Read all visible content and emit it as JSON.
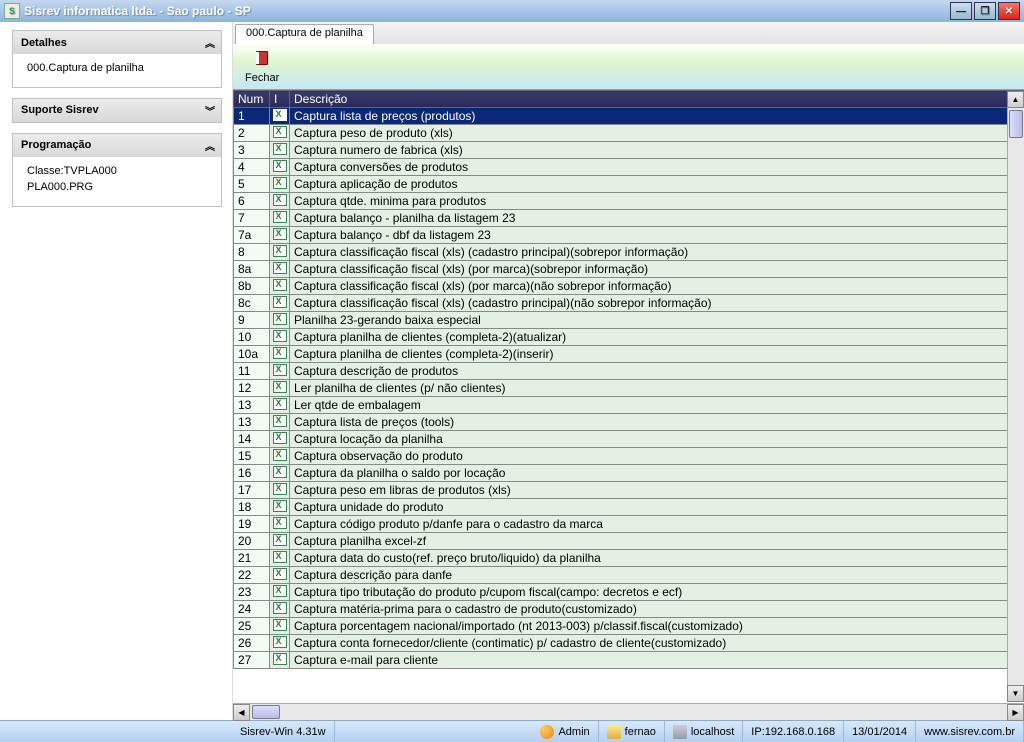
{
  "window": {
    "title": "Sisrev informatica ltda. - Sao paulo - SP"
  },
  "sidebar": {
    "detalhes": {
      "title": "Detalhes",
      "item": "000.Captura de planilha"
    },
    "suporte": {
      "title": "Suporte Sisrev"
    },
    "programacao": {
      "title": "Programação",
      "line1": "Classe:TVPLA000",
      "line2": "PLA000.PRG"
    }
  },
  "tab": {
    "label": "000.Captura de planilha"
  },
  "toolbar": {
    "fechar": "Fechar"
  },
  "grid": {
    "headers": {
      "num": "Num",
      "i": "I",
      "desc": "Descrição"
    },
    "rows": [
      {
        "num": "1",
        "desc": "Captura lista de preços (produtos)",
        "selected": true
      },
      {
        "num": "2",
        "desc": "Captura peso de produto (xls)"
      },
      {
        "num": "3",
        "desc": "Captura numero de fabrica (xls)"
      },
      {
        "num": "4",
        "desc": "Captura conversões de produtos"
      },
      {
        "num": "5",
        "desc": "Captura aplicação de produtos"
      },
      {
        "num": "6",
        "desc": "Captura qtde. minima para produtos"
      },
      {
        "num": "7",
        "desc": "Captura balanço - planilha da listagem 23"
      },
      {
        "num": "7a",
        "desc": "Captura balanço - dbf da listagem 23"
      },
      {
        "num": "8",
        "desc": "Captura classificação fiscal (xls) (cadastro principal)(sobrepor informação)"
      },
      {
        "num": "8a",
        "desc": "Captura classificação fiscal (xls) (por marca)(sobrepor informação)"
      },
      {
        "num": "8b",
        "desc": "Captura classificação fiscal (xls) (por marca)(não sobrepor informação)"
      },
      {
        "num": "8c",
        "desc": "Captura classificação fiscal (xls) (cadastro principal)(não sobrepor informação)"
      },
      {
        "num": "9",
        "desc": "Planilha 23-gerando baixa especial"
      },
      {
        "num": "10",
        "desc": "Captura planilha de clientes (completa-2)(atualizar)"
      },
      {
        "num": "10a",
        "desc": "Captura planilha de clientes (completa-2)(inserir)"
      },
      {
        "num": "11",
        "desc": "Captura descrição de produtos"
      },
      {
        "num": "12",
        "desc": "Ler planilha de clientes (p/ não clientes)"
      },
      {
        "num": "13",
        "desc": "Ler qtde de embalagem"
      },
      {
        "num": "13",
        "desc": "Captura lista de preços (tools)"
      },
      {
        "num": "14",
        "desc": "Captura locação da planilha"
      },
      {
        "num": "15",
        "desc": "Captura observação do produto"
      },
      {
        "num": "16",
        "desc": "Captura da planilha o saldo por locação"
      },
      {
        "num": "17",
        "desc": "Captura peso em libras de produtos (xls)"
      },
      {
        "num": "18",
        "desc": "Captura unidade do produto"
      },
      {
        "num": "19",
        "desc": "Captura código produto p/danfe para o cadastro da marca"
      },
      {
        "num": "20",
        "desc": "Captura planilha excel-zf"
      },
      {
        "num": "21",
        "desc": "Captura data do custo(ref. preço bruto/liquido) da planilha"
      },
      {
        "num": "22",
        "desc": "Captura descrição para danfe"
      },
      {
        "num": "23",
        "desc": "Captura tipo tributação do produto p/cupom fiscal(campo: decretos e ecf)"
      },
      {
        "num": "24",
        "desc": "Captura matéria-prima para o cadastro de produto(customizado)"
      },
      {
        "num": "25",
        "desc": "Captura porcentagem nacional/importado (nt 2013-003) p/classif.fiscal(customizado)"
      },
      {
        "num": "26",
        "desc": "Captura conta fornecedor/cliente (contimatic) p/ cadastro de cliente(customizado)"
      },
      {
        "num": "27",
        "desc": "Captura e-mail para cliente"
      }
    ]
  },
  "status": {
    "version": "Sisrev-Win 4.31w",
    "user": "Admin",
    "db": "fernao",
    "server": "localhost",
    "ip": "IP:192.168.0.168",
    "date": "13/01/2014",
    "url": "www.sisrev.com.br"
  }
}
